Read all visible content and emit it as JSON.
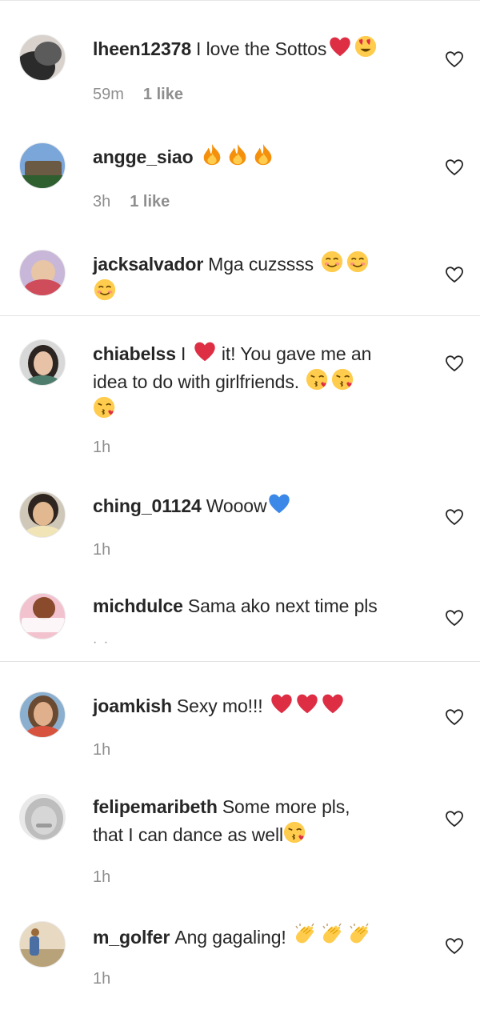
{
  "comments": [
    {
      "username": "lheen12378",
      "text": "I love the Sottos",
      "emojis": [
        "heart-red",
        "heart-eyes"
      ],
      "time": "59m",
      "likes": "1 like",
      "avatar_colors": [
        "#5b5b5b",
        "#d9d2cc",
        "#2b2b2b"
      ]
    },
    {
      "username": "angge_siao",
      "text": "",
      "emojis": [
        "fire",
        "fire",
        "fire"
      ],
      "time": "3h",
      "likes": "1 like",
      "avatar_colors": [
        "#7aa6d9",
        "#6b5a44",
        "#2f5e2f"
      ]
    },
    {
      "username": "jacksalvador",
      "text": "Mga cuzssss",
      "emojis": [
        "blush",
        "blush",
        "blush"
      ],
      "time": "",
      "likes": "",
      "avatar_colors": [
        "#c8b7d8",
        "#cf4c5a",
        "#e8c6a5"
      ]
    },
    {
      "username": "chiabelss",
      "text_lines": [
        "I",
        "it! You gave me an",
        "idea to do with girlfriends."
      ],
      "emojis": [
        "kiss",
        "kiss",
        "kiss"
      ],
      "time": "1h",
      "likes": "",
      "avatar_colors": [
        "#d8d8d8",
        "#2b2420",
        "#e7c2a6"
      ]
    },
    {
      "username": "ching_01124",
      "text": "Wooow",
      "emojis": [
        "heart-blue"
      ],
      "time": "1h",
      "likes": "",
      "avatar_colors": [
        "#cfc7b8",
        "#2e2520",
        "#e1b890"
      ]
    },
    {
      "username": "michdulce",
      "text": "Sama ako next time pls",
      "emojis": [],
      "time": "",
      "likes": "",
      "avatar_colors": [
        "#f2c3cf",
        "#8a4a2c",
        "#ffffff"
      ]
    },
    {
      "username": "joamkish",
      "text": "Sexy mo!!!",
      "emojis": [
        "heart-red",
        "heart-red",
        "heart-red"
      ],
      "time": "1h",
      "likes": "",
      "avatar_colors": [
        "#8bb0cf",
        "#6b4a32",
        "#d8533e"
      ]
    },
    {
      "username": "felipemaribeth",
      "text_lines": [
        "Some more pls,",
        "that I can dance as well"
      ],
      "emojis": [
        "kiss"
      ],
      "time": "1h",
      "likes": "",
      "avatar_colors": [
        "#e9e9e9",
        "#9a9a9a",
        "#bdbdbd"
      ]
    },
    {
      "username": "m_golfer",
      "text": "Ang gagaling!",
      "emojis": [
        "clap",
        "clap",
        "clap"
      ],
      "time": "1h",
      "likes": "",
      "avatar_colors": [
        "#e8d9c2",
        "#4b6ea3",
        "#9a6a3a"
      ]
    }
  ],
  "more_indicator": "· ·",
  "colors": {
    "text": "#262626",
    "meta": "#8e8e8e",
    "divider": "#e3e3e3",
    "heart": "#ed4956",
    "blue_heart": "#3b88e8",
    "emoji_yellow": "#ffcc4d",
    "fire": "#f4900c"
  }
}
